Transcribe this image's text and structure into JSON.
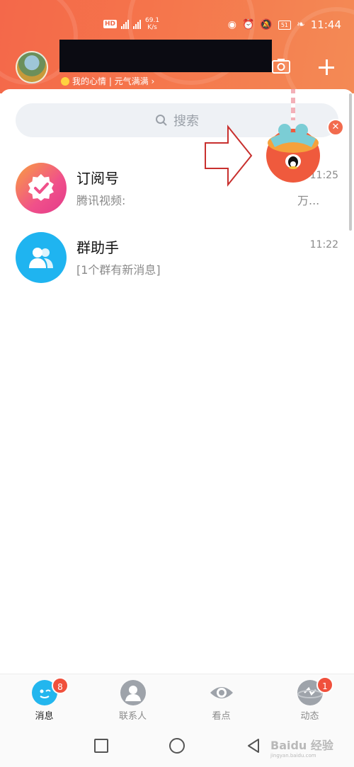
{
  "status_bar": {
    "hd": "HD",
    "net_speed_value": "69.1",
    "net_speed_unit": "K/s",
    "battery": "51",
    "time": "11:44"
  },
  "header": {
    "mood_text": "我的心情 | 元气满满 ›"
  },
  "search": {
    "placeholder": "搜索"
  },
  "chats": [
    {
      "title": "订阅号",
      "preview": "腾讯视频:",
      "preview_tail": "万...",
      "time": "11:25",
      "icon": "verified-badge-icon"
    },
    {
      "title": "群助手",
      "preview": "[1个群有新消息]",
      "time": "11:22",
      "icon": "group-icon"
    }
  ],
  "tabs": [
    {
      "label": "消息",
      "badge": "8",
      "icon": "message-icon"
    },
    {
      "label": "联系人",
      "icon": "contacts-icon"
    },
    {
      "label": "看点",
      "icon": "eye-icon"
    },
    {
      "label": "动态",
      "badge": "1",
      "icon": "planet-icon"
    }
  ],
  "watermark": {
    "brand": "Baidu 经验",
    "url": "jingyan.baidu.com"
  },
  "colors": {
    "header": "#f5744b",
    "subscription": "#f0508a",
    "group_helper": "#1fb4f0",
    "badge": "#f0503c"
  }
}
